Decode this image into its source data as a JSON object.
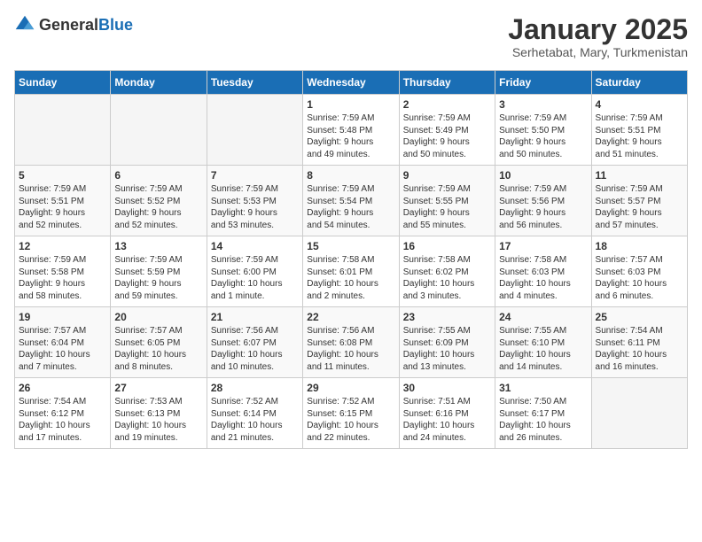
{
  "logo": {
    "general": "General",
    "blue": "Blue"
  },
  "title": "January 2025",
  "subtitle": "Serhetabat, Mary, Turkmenistan",
  "days_of_week": [
    "Sunday",
    "Monday",
    "Tuesday",
    "Wednesday",
    "Thursday",
    "Friday",
    "Saturday"
  ],
  "weeks": [
    [
      {
        "day": "",
        "detail": ""
      },
      {
        "day": "",
        "detail": ""
      },
      {
        "day": "",
        "detail": ""
      },
      {
        "day": "1",
        "detail": "Sunrise: 7:59 AM\nSunset: 5:48 PM\nDaylight: 9 hours\nand 49 minutes."
      },
      {
        "day": "2",
        "detail": "Sunrise: 7:59 AM\nSunset: 5:49 PM\nDaylight: 9 hours\nand 50 minutes."
      },
      {
        "day": "3",
        "detail": "Sunrise: 7:59 AM\nSunset: 5:50 PM\nDaylight: 9 hours\nand 50 minutes."
      },
      {
        "day": "4",
        "detail": "Sunrise: 7:59 AM\nSunset: 5:51 PM\nDaylight: 9 hours\nand 51 minutes."
      }
    ],
    [
      {
        "day": "5",
        "detail": "Sunrise: 7:59 AM\nSunset: 5:51 PM\nDaylight: 9 hours\nand 52 minutes."
      },
      {
        "day": "6",
        "detail": "Sunrise: 7:59 AM\nSunset: 5:52 PM\nDaylight: 9 hours\nand 52 minutes."
      },
      {
        "day": "7",
        "detail": "Sunrise: 7:59 AM\nSunset: 5:53 PM\nDaylight: 9 hours\nand 53 minutes."
      },
      {
        "day": "8",
        "detail": "Sunrise: 7:59 AM\nSunset: 5:54 PM\nDaylight: 9 hours\nand 54 minutes."
      },
      {
        "day": "9",
        "detail": "Sunrise: 7:59 AM\nSunset: 5:55 PM\nDaylight: 9 hours\nand 55 minutes."
      },
      {
        "day": "10",
        "detail": "Sunrise: 7:59 AM\nSunset: 5:56 PM\nDaylight: 9 hours\nand 56 minutes."
      },
      {
        "day": "11",
        "detail": "Sunrise: 7:59 AM\nSunset: 5:57 PM\nDaylight: 9 hours\nand 57 minutes."
      }
    ],
    [
      {
        "day": "12",
        "detail": "Sunrise: 7:59 AM\nSunset: 5:58 PM\nDaylight: 9 hours\nand 58 minutes."
      },
      {
        "day": "13",
        "detail": "Sunrise: 7:59 AM\nSunset: 5:59 PM\nDaylight: 9 hours\nand 59 minutes."
      },
      {
        "day": "14",
        "detail": "Sunrise: 7:59 AM\nSunset: 6:00 PM\nDaylight: 10 hours\nand 1 minute."
      },
      {
        "day": "15",
        "detail": "Sunrise: 7:58 AM\nSunset: 6:01 PM\nDaylight: 10 hours\nand 2 minutes."
      },
      {
        "day": "16",
        "detail": "Sunrise: 7:58 AM\nSunset: 6:02 PM\nDaylight: 10 hours\nand 3 minutes."
      },
      {
        "day": "17",
        "detail": "Sunrise: 7:58 AM\nSunset: 6:03 PM\nDaylight: 10 hours\nand 4 minutes."
      },
      {
        "day": "18",
        "detail": "Sunrise: 7:57 AM\nSunset: 6:03 PM\nDaylight: 10 hours\nand 6 minutes."
      }
    ],
    [
      {
        "day": "19",
        "detail": "Sunrise: 7:57 AM\nSunset: 6:04 PM\nDaylight: 10 hours\nand 7 minutes."
      },
      {
        "day": "20",
        "detail": "Sunrise: 7:57 AM\nSunset: 6:05 PM\nDaylight: 10 hours\nand 8 minutes."
      },
      {
        "day": "21",
        "detail": "Sunrise: 7:56 AM\nSunset: 6:07 PM\nDaylight: 10 hours\nand 10 minutes."
      },
      {
        "day": "22",
        "detail": "Sunrise: 7:56 AM\nSunset: 6:08 PM\nDaylight: 10 hours\nand 11 minutes."
      },
      {
        "day": "23",
        "detail": "Sunrise: 7:55 AM\nSunset: 6:09 PM\nDaylight: 10 hours\nand 13 minutes."
      },
      {
        "day": "24",
        "detail": "Sunrise: 7:55 AM\nSunset: 6:10 PM\nDaylight: 10 hours\nand 14 minutes."
      },
      {
        "day": "25",
        "detail": "Sunrise: 7:54 AM\nSunset: 6:11 PM\nDaylight: 10 hours\nand 16 minutes."
      }
    ],
    [
      {
        "day": "26",
        "detail": "Sunrise: 7:54 AM\nSunset: 6:12 PM\nDaylight: 10 hours\nand 17 minutes."
      },
      {
        "day": "27",
        "detail": "Sunrise: 7:53 AM\nSunset: 6:13 PM\nDaylight: 10 hours\nand 19 minutes."
      },
      {
        "day": "28",
        "detail": "Sunrise: 7:52 AM\nSunset: 6:14 PM\nDaylight: 10 hours\nand 21 minutes."
      },
      {
        "day": "29",
        "detail": "Sunrise: 7:52 AM\nSunset: 6:15 PM\nDaylight: 10 hours\nand 22 minutes."
      },
      {
        "day": "30",
        "detail": "Sunrise: 7:51 AM\nSunset: 6:16 PM\nDaylight: 10 hours\nand 24 minutes."
      },
      {
        "day": "31",
        "detail": "Sunrise: 7:50 AM\nSunset: 6:17 PM\nDaylight: 10 hours\nand 26 minutes."
      },
      {
        "day": "",
        "detail": ""
      }
    ]
  ]
}
